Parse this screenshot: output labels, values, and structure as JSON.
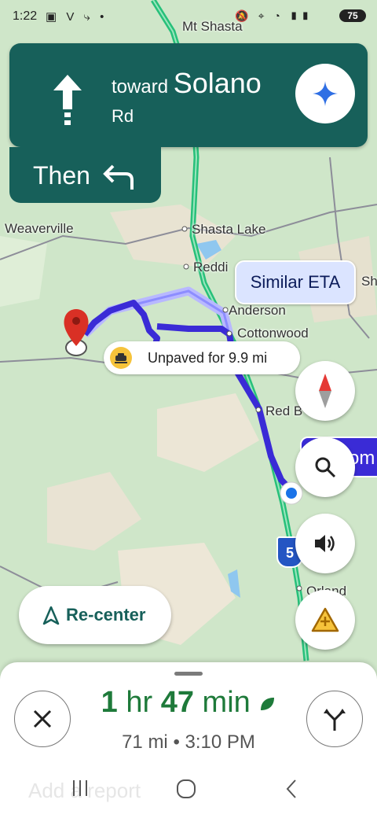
{
  "status_bar": {
    "time": "1:22",
    "left_icons": "▣ V ⤷ •",
    "right_icons": "🔕 ⌖ ◔ ▮▮",
    "battery": "75"
  },
  "nav": {
    "toward_prefix": "toward",
    "road_name": "Solano",
    "road_line2": "Rd",
    "then_label": "Then"
  },
  "map": {
    "places": [
      "Mt Shasta",
      "Weaverville",
      "Shasta Lake",
      "Reddi",
      "Anderson",
      "Cottonwood",
      "Red B",
      "Orland",
      "Sh"
    ],
    "similar_eta": "Similar ETA",
    "unpaved": "Unpaved for 9.9 mi",
    "route_tag": "om",
    "interstate": "5"
  },
  "controls": {
    "recenter": "Re-center"
  },
  "trip": {
    "hours": "1",
    "hr_unit": "hr",
    "minutes": "47",
    "min_unit": "min",
    "distance": "71 mi",
    "sep": "•",
    "arrival": "3:10 PM"
  },
  "sheet": {
    "add_report_ghost": "Add a report"
  },
  "colors": {
    "nav_green": "#17605a",
    "route_blue": "#3a2bd6",
    "eta_green": "#1e7a3a",
    "highway_green": "#27c07a"
  }
}
